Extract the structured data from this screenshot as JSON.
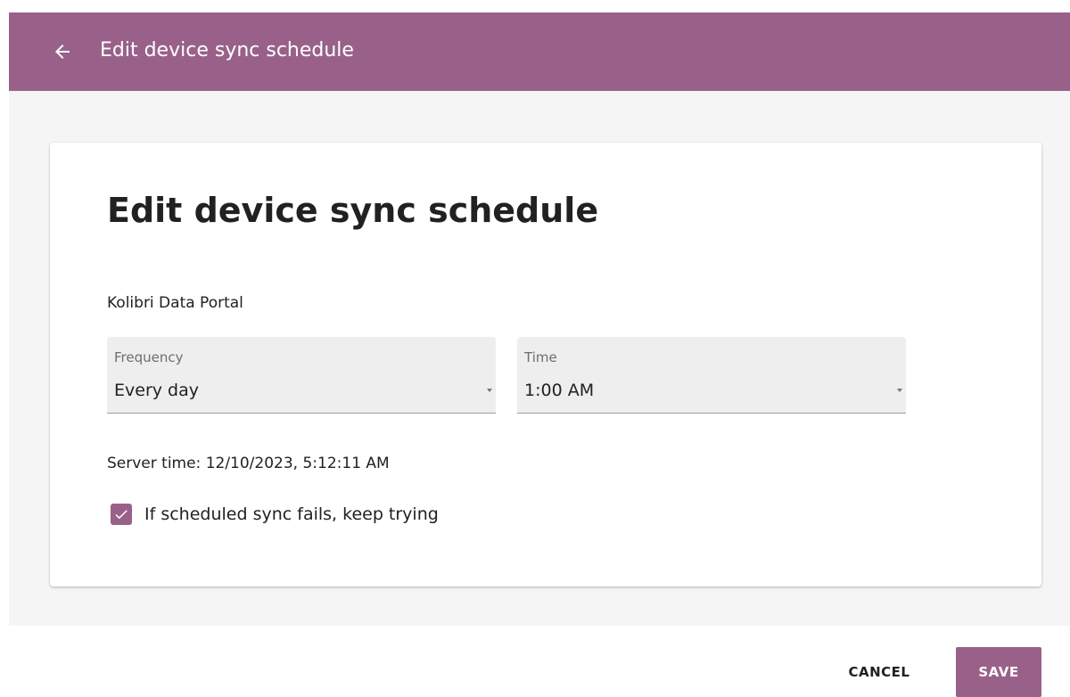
{
  "colors": {
    "brand": "#996189",
    "appbar_text": "#ffffff",
    "background": "#f5f5f5",
    "card": "#ffffff"
  },
  "appbar": {
    "back_icon": "arrow-left-icon",
    "title": "Edit device sync schedule"
  },
  "card": {
    "title": "Edit device sync schedule",
    "device_name": "Kolibri Data Portal",
    "frequency": {
      "label": "Frequency",
      "value": "Every day",
      "icon": "caret-down-icon"
    },
    "time": {
      "label": "Time",
      "value": "1:00 AM",
      "icon": "caret-down-icon"
    },
    "server_time": "Server time: 12/10/2023, 5:12:11 AM",
    "retry_checkbox": {
      "label": "If scheduled sync fails, keep trying",
      "checked": true,
      "icon": "checkmark-icon"
    }
  },
  "footer": {
    "cancel_label": "CANCEL",
    "save_label": "SAVE"
  }
}
